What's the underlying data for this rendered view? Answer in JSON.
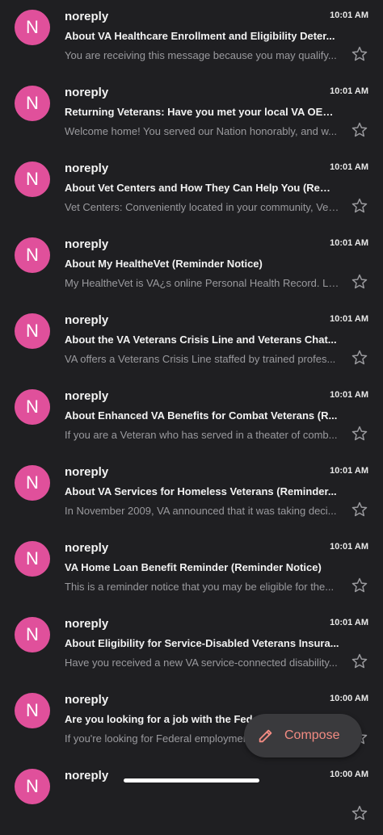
{
  "colors": {
    "background": "#1f1f22",
    "avatar": "#e0509b",
    "compose_text": "#f28b82",
    "star_outline": "#9a9a9e"
  },
  "emails": [
    {
      "initial": "N",
      "sender": "noreply",
      "time": "10:01 AM",
      "subject": "About VA Healthcare Enrollment and Eligibility Deter...",
      "snippet": "You are receiving this message because you may qualify...",
      "starred": false,
      "star_icon": "star-outline-icon"
    },
    {
      "initial": "N",
      "sender": "noreply",
      "time": "10:01 AM",
      "subject": "Returning Veterans: Have you met your local VA OEF/...",
      "snippet": "Welcome home! You served our Nation honorably, and w...",
      "starred": false,
      "star_icon": "star-outline-icon"
    },
    {
      "initial": "N",
      "sender": "noreply",
      "time": "10:01 AM",
      "subject": "About Vet Centers and How They Can Help You (Remin...",
      "snippet": "Vet Centers: Conveniently located in your community, Vet...",
      "starred": false,
      "star_icon": "star-outline-icon"
    },
    {
      "initial": "N",
      "sender": "noreply",
      "time": "10:01 AM",
      "subject": "About My HealtheVet (Reminder Notice)",
      "snippet": "My HealtheVet is VA¿s online Personal Health Record. La...",
      "starred": false,
      "star_icon": "star-outline-icon"
    },
    {
      "initial": "N",
      "sender": "noreply",
      "time": "10:01 AM",
      "subject": "About the VA Veterans Crisis Line and Veterans Chat...",
      "snippet": "VA offers a Veterans Crisis Line staffed by trained profes...",
      "starred": false,
      "star_icon": "star-outline-icon"
    },
    {
      "initial": "N",
      "sender": "noreply",
      "time": "10:01 AM",
      "subject": "About Enhanced VA Benefits for Combat Veterans (R...",
      "snippet": "If you are a Veteran who has served in a theater of comb...",
      "starred": false,
      "star_icon": "star-outline-icon"
    },
    {
      "initial": "N",
      "sender": "noreply",
      "time": "10:01 AM",
      "subject": "About VA Services for Homeless Veterans (Reminder...",
      "snippet": "In November 2009, VA announced that it was taking deci...",
      "starred": false,
      "star_icon": "star-outline-icon"
    },
    {
      "initial": "N",
      "sender": "noreply",
      "time": "10:01 AM",
      "subject": "VA Home Loan Benefit Reminder (Reminder Notice)",
      "snippet": "This is a reminder notice that you may be eligible for the...",
      "starred": false,
      "star_icon": "star-outline-icon"
    },
    {
      "initial": "N",
      "sender": "noreply",
      "time": "10:01 AM",
      "subject": "About Eligibility for Service-Disabled Veterans Insura...",
      "snippet": "Have you received a new VA service-connected disability...",
      "starred": false,
      "star_icon": "star-outline-icon"
    },
    {
      "initial": "N",
      "sender": "noreply",
      "time": "10:00 AM",
      "subject": "Are you looking for a job with the Federal Government...",
      "snippet": "If you're looking for Federal employment...",
      "starred": false,
      "star_icon": "star-outline-icon"
    },
    {
      "initial": "N",
      "sender": "noreply",
      "time": "10:00 AM",
      "subject": "",
      "snippet": "",
      "starred": false,
      "star_icon": "star-outline-icon"
    }
  ],
  "compose": {
    "label": "Compose",
    "icon": "pencil-icon"
  }
}
